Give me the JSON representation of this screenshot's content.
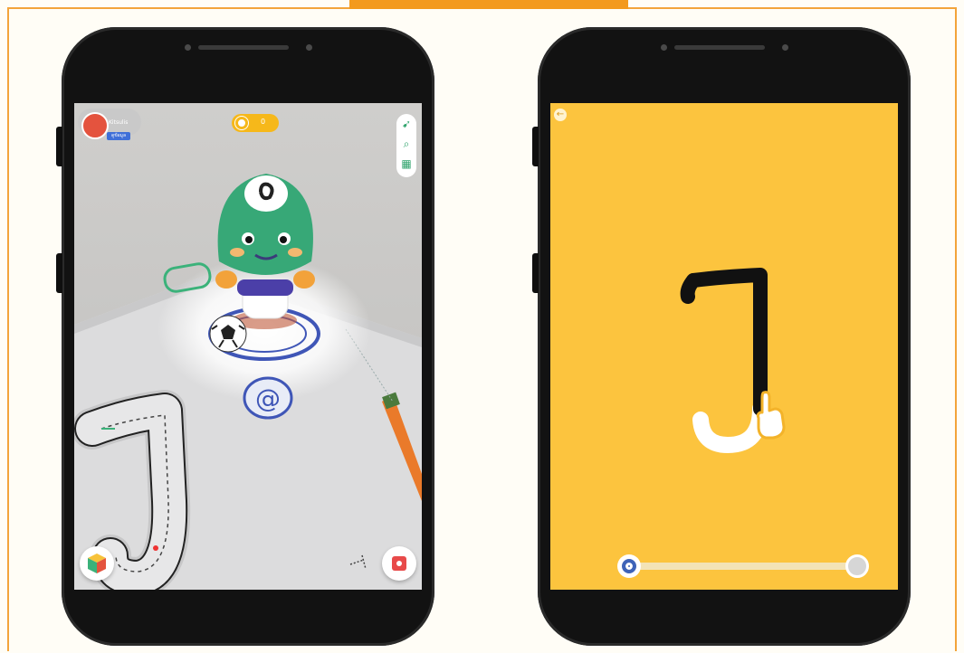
{
  "colors": {
    "frame_border": "#f3a43a",
    "top_tab": "#f39a1e",
    "trace_background": "#fcc43e",
    "character_green": "#2fa36c",
    "slider_knob_blue": "#3e63b8"
  },
  "left_phone": {
    "profile": {
      "name": "Kitsulis",
      "badge": "ดูข้อมูล",
      "avatar_icon": "mascot-avatar-icon"
    },
    "coins": {
      "value": "0",
      "icon": "coin-icon"
    },
    "toolbar": {
      "items": [
        {
          "name": "compass-icon",
          "glyph": "➹"
        },
        {
          "name": "search-icon",
          "glyph": "⌕"
        },
        {
          "name": "book-icon",
          "glyph": "▦"
        }
      ]
    },
    "scene": {
      "marker_symbol": "@",
      "traced_letter": "ๅ"
    },
    "buttons": {
      "left": "cube-icon",
      "right": "record-icon"
    }
  },
  "right_phone": {
    "back_icon": "back-arrow-icon",
    "letter": "ๅ",
    "hand_icon": "pointing-hand-icon",
    "progress": 0.0
  }
}
